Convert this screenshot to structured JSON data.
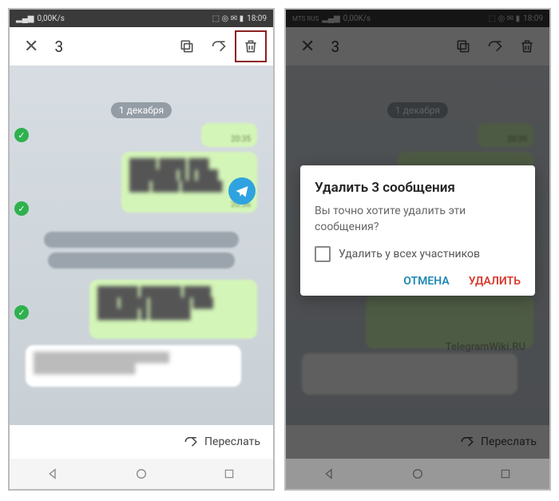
{
  "status": {
    "carrier_left": "MTS RUS",
    "speed": "0,00K/s",
    "time": "18:09"
  },
  "actionbar": {
    "count": "3"
  },
  "chat": {
    "date": "1 декабря",
    "msg1_time": "20:35",
    "msg2_time": "20:36"
  },
  "forward": {
    "label": "Переслать"
  },
  "dialog": {
    "title": "Удалить 3 сообщения",
    "body": "Вы точно хотите удалить эти сообщения?",
    "checkbox": "Удалить у всех участников",
    "cancel": "ОТМЕНА",
    "delete": "УДАЛИТЬ"
  },
  "watermark": "TelegramWiki.RU"
}
